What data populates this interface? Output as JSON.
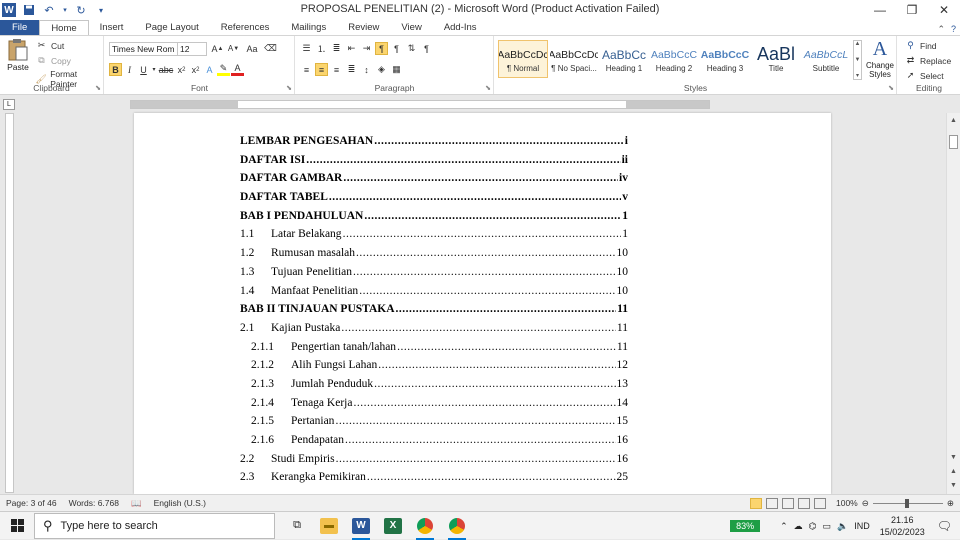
{
  "window": {
    "title": "PROPOSAL PENELITIAN (2)  -  Microsoft Word (Product Activation Failed)",
    "app_icon": "W"
  },
  "tabs": [
    "File",
    "Home",
    "Insert",
    "Page Layout",
    "References",
    "Mailings",
    "Review",
    "View",
    "Add-Ins"
  ],
  "active_tab": "Home",
  "ribbon": {
    "clipboard": {
      "label": "Clipboard",
      "paste": "Paste",
      "cut": "Cut",
      "copy": "Copy",
      "format_painter": "Format Painter"
    },
    "font": {
      "label": "Font",
      "font_name": "Times New Rom",
      "font_size": "12",
      "case": "Aa"
    },
    "paragraph": {
      "label": "Paragraph"
    },
    "styles": {
      "label": "Styles",
      "items": [
        {
          "preview": "AaBbCcDc",
          "name": "¶ Normal"
        },
        {
          "preview": "AaBbCcDc",
          "name": "¶ No Spaci..."
        },
        {
          "preview": "AaBbCc",
          "name": "Heading 1"
        },
        {
          "preview": "AaBbCcC",
          "name": "Heading 2"
        },
        {
          "preview": "AaBbCcC",
          "name": "Heading 3"
        },
        {
          "preview": "AaBl",
          "name": "Title"
        },
        {
          "preview": "AaBbCcL",
          "name": "Subtitle"
        }
      ],
      "change_styles": "Change Styles",
      "change_styles_preview": "A"
    },
    "editing": {
      "label": "Editing",
      "find": "Find",
      "replace": "Replace",
      "select": "Select"
    }
  },
  "toc": [
    {
      "level": 0,
      "bold": true,
      "num": "",
      "text": "LEMBAR PENGESAHAN",
      "page": "i"
    },
    {
      "level": 0,
      "bold": true,
      "num": "",
      "text": "DAFTAR ISI",
      "page": "ii"
    },
    {
      "level": 0,
      "bold": true,
      "num": "",
      "text": "DAFTAR GAMBAR",
      "page": "iv"
    },
    {
      "level": 0,
      "bold": true,
      "num": "",
      "text": "DAFTAR TABEL",
      "page": "v"
    },
    {
      "level": 0,
      "bold": true,
      "num": "",
      "text": "BAB I PENDAHULUAN",
      "page": "1"
    },
    {
      "level": 1,
      "bold": false,
      "num": "1.1",
      "text": "Latar Belakang",
      "page": "1"
    },
    {
      "level": 1,
      "bold": false,
      "num": "1.2",
      "text": "Rumusan masalah",
      "page": "10"
    },
    {
      "level": 1,
      "bold": false,
      "num": "1.3",
      "text": "Tujuan Penelitian",
      "page": "10"
    },
    {
      "level": 1,
      "bold": false,
      "num": "1.4",
      "text": "Manfaat Penelitian",
      "page": "10"
    },
    {
      "level": 0,
      "bold": true,
      "num": "",
      "text": "BAB II TINJAUAN PUSTAKA",
      "page": "11"
    },
    {
      "level": 1,
      "bold": false,
      "num": "2.1",
      "text": "Kajian Pustaka",
      "page": "11"
    },
    {
      "level": 2,
      "bold": false,
      "num": "2.1.1",
      "text": "Pengertian tanah/lahan",
      "page": "11"
    },
    {
      "level": 2,
      "bold": false,
      "num": "2.1.2",
      "text": "Alih Fungsi Lahan",
      "page": "12"
    },
    {
      "level": 2,
      "bold": false,
      "num": "2.1.3",
      "text": "Jumlah Penduduk",
      "page": "13"
    },
    {
      "level": 2,
      "bold": false,
      "num": "2.1.4",
      "text": "Tenaga Kerja",
      "page": "14"
    },
    {
      "level": 2,
      "bold": false,
      "num": "2.1.5",
      "text": "Pertanian",
      "page": "15"
    },
    {
      "level": 2,
      "bold": false,
      "num": "2.1.6",
      "text": "Pendapatan",
      "page": "16"
    },
    {
      "level": 1,
      "bold": false,
      "num": "2.2",
      "text": "Studi Empiris",
      "page": "16"
    },
    {
      "level": 1,
      "bold": false,
      "num": "2.3",
      "text": "Kerangka Pemikiran",
      "page": "25"
    }
  ],
  "status": {
    "page": "Page: 3 of 46",
    "words": "Words: 6.768",
    "language": "English (U.S.)",
    "zoom": "100%"
  },
  "taskbar": {
    "search_placeholder": "Type here to search",
    "battery": "83%",
    "lang": "IND",
    "time": "21.16",
    "date": "15/02/2023"
  },
  "colors": {
    "word_blue": "#2b579a",
    "battery_green": "#1e9e45"
  }
}
